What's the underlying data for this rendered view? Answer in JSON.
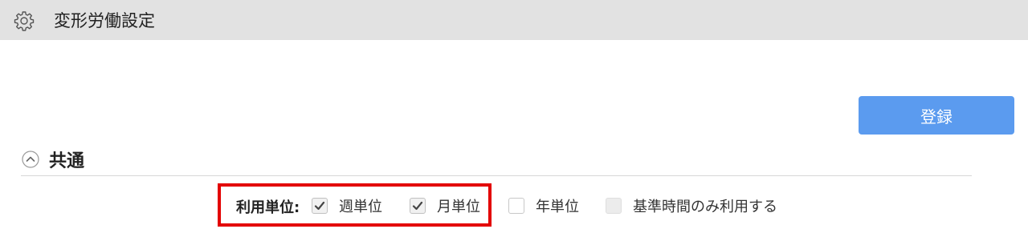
{
  "header": {
    "icon": "gear-icon",
    "title": "変形労働設定"
  },
  "actions": {
    "register_label": "登録",
    "register_color": "#5b9bef"
  },
  "section": {
    "icon": "chevron-up-circle-icon",
    "title": "共通"
  },
  "usage_unit": {
    "label": "利用単位:",
    "options": [
      {
        "label": "週単位",
        "checked": true
      },
      {
        "label": "月単位",
        "checked": true
      },
      {
        "label": "年単位",
        "checked": false
      },
      {
        "label": "基準時間のみ利用する",
        "checked": false,
        "disabled": true
      }
    ]
  },
  "highlight_color": "#e30000"
}
